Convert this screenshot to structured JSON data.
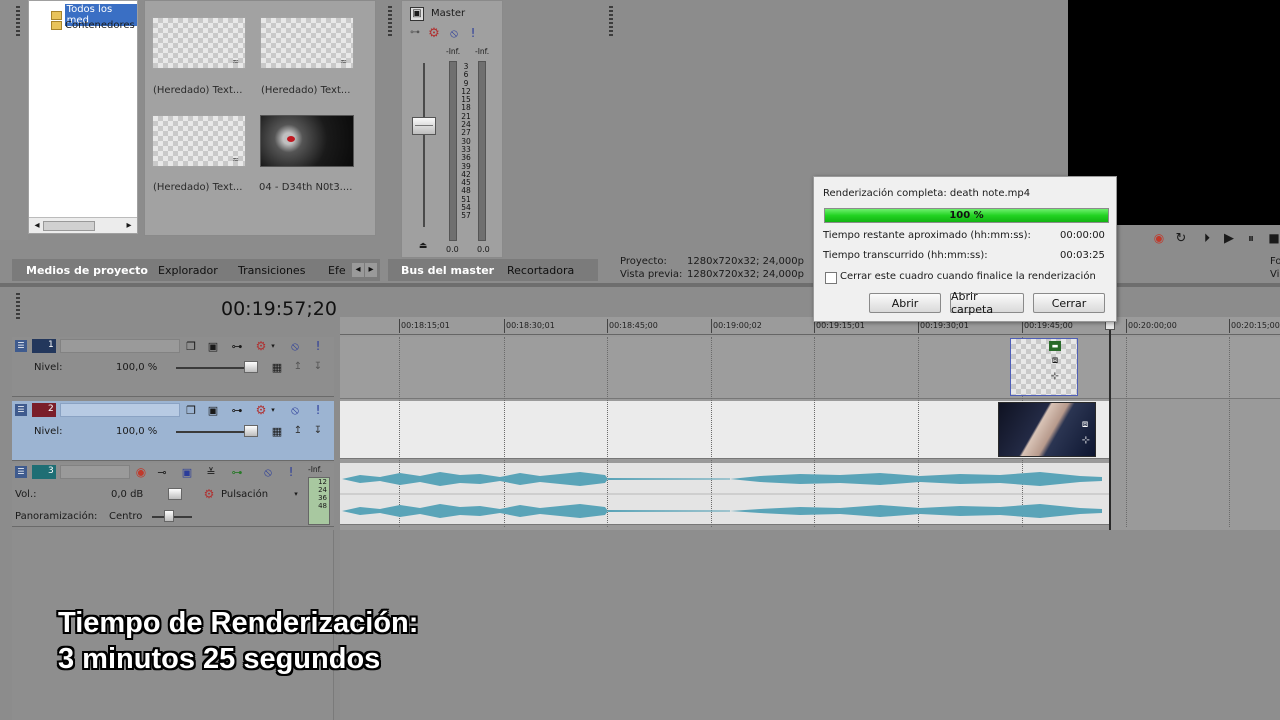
{
  "explorer_tree": {
    "items": [
      "Todos los med",
      "Contenedores"
    ]
  },
  "media_items": [
    {
      "label": "(Heredado) Text..."
    },
    {
      "label": "(Heredado) Text..."
    },
    {
      "label": "(Heredado) Text..."
    },
    {
      "label": "04 - D34th N0t3...."
    }
  ],
  "left_tabs": {
    "items": [
      "Medios de proyecto",
      "Explorador",
      "Transiciones",
      "Efe"
    ]
  },
  "master": {
    "title": "Master",
    "peak_left": "-Inf.",
    "peak_right": "-Inf.",
    "scale": [
      "3",
      "6",
      "9",
      "12",
      "15",
      "18",
      "21",
      "24",
      "27",
      "30",
      "33",
      "36",
      "39",
      "42",
      "45",
      "48",
      "51",
      "54",
      "57"
    ],
    "value_left": "0.0",
    "value_right": "0.0",
    "tabs": [
      "Bus del master",
      "Recortadora"
    ]
  },
  "preview_info": {
    "project_label": "Proyecto:",
    "project_value": "1280x720x32; 24,000p",
    "preview_label": "Vista previa:",
    "preview_value": "1280x720x32; 24,000p",
    "clipped_right_1": "Fo",
    "clipped_right_2": "Vi"
  },
  "timecode": "00:19:57;20",
  "ruler": [
    "00:18:15;01",
    "00:18:30;01",
    "00:18:45;00",
    "00:19:00;02",
    "00:19:15;01",
    "00:19:30;01",
    "00:19:45;00",
    "00:20:00;00",
    "00:20:15;00"
  ],
  "tracks": [
    {
      "number": "1",
      "level_label": "Nivel:",
      "level_value": "100,0 %"
    },
    {
      "number": "2",
      "level_label": "Nivel:",
      "level_value": "100,0 %"
    },
    {
      "number": "3",
      "vol_label": "Vol.:",
      "vol_value": "0,0 dB",
      "mode": "Pulsación",
      "pan_label": "Panoramización:",
      "pan_value": "Centro",
      "peak": "-Inf.",
      "meter_scale": [
        "12",
        "24",
        "36",
        "48"
      ]
    }
  ],
  "dialog": {
    "title": "Renderización completa: death note.mp4",
    "progress": 100,
    "progress_text": "100 %",
    "remaining_label": "Tiempo restante aproximado (hh:mm:ss):",
    "remaining_value": "00:00:00",
    "elapsed_label": "Tiempo transcurrido (hh:mm:ss):",
    "elapsed_value": "00:03:25",
    "checkbox_label": "Cerrar este cuadro cuando finalice la renderización",
    "open_label": "Abrir",
    "open_folder_label": "Abrir carpeta",
    "close_label": "Cerrar"
  },
  "overlay": {
    "line1": "Tiempo de Renderización:",
    "line2": "3 minutos 25 segundos"
  },
  "colors": {
    "progress": "#22d322",
    "track_selected": "#9cb4d2",
    "waveform": "#5aa4b8",
    "record": "#c0392b"
  }
}
